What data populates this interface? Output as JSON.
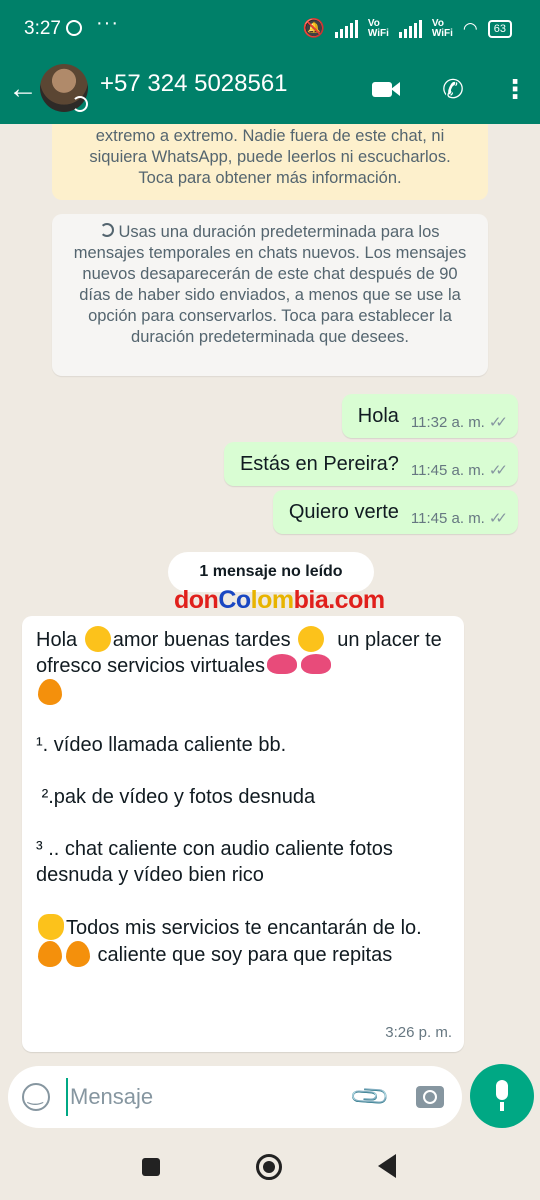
{
  "status_bar": {
    "time": "3:27",
    "battery": "63",
    "vowifi_1": "Vo\nWiFi",
    "vowifi_2": "Vo\nWiFi"
  },
  "header": {
    "contact": "+57 324 5028561"
  },
  "chat": {
    "encryption_notice": "extremo a extremo. Nadie fuera de este chat, ni siquiera WhatsApp, puede leerlos ni escucharlos. Toca para obtener más información.",
    "temporary_notice": "Usas una duración predeterminada para los mensajes temporales en chats nuevos. Los mensajes nuevos desaparecerán de este chat después de 90 días de haber sido enviados, a menos que se use la opción para conservarlos. Toca para establecer la duración predeterminada que desees.",
    "outgoing": [
      {
        "text": "Hola",
        "time": "11:32 a. m."
      },
      {
        "text": "Estás en Pereira?",
        "time": "11:45 a. m."
      },
      {
        "text": "Quiero verte",
        "time": "11:45 a. m."
      }
    ],
    "unread_label": "1 mensaje no leído",
    "watermark": {
      "part1": "don",
      "part2": "Co",
      "part3": "lom",
      "part4": "bia.com"
    },
    "incoming": {
      "line1a": "Hola ",
      "line1b": "amor buenas tardes ",
      "line1c": "  un placer te ofresco servicios virtuales",
      "item1": "¹. vídeo llamada caliente bb.",
      "item2": " ².pak de vídeo y fotos desnuda",
      "item3": "³ .. chat caliente con audio caliente fotos desnuda y vídeo bien rico",
      "closing_a": "Todos mis servicios te encantarán de lo. ",
      "closing_b": " caliente que soy para que repitas",
      "time": "3:26 p. m."
    }
  },
  "composer": {
    "placeholder": "Mensaje"
  },
  "colors": {
    "header": "#008069",
    "outgoing_bubble": "#d9fdd3",
    "accent": "#00a884",
    "chat_bg": "#efeae2"
  },
  "icons": [
    "back-arrow-icon",
    "video-call-icon",
    "phone-call-icon",
    "menu-icon",
    "emoji-icon",
    "attach-icon",
    "camera-icon",
    "mic-icon",
    "read-ticks-icon",
    "timer-icon"
  ]
}
